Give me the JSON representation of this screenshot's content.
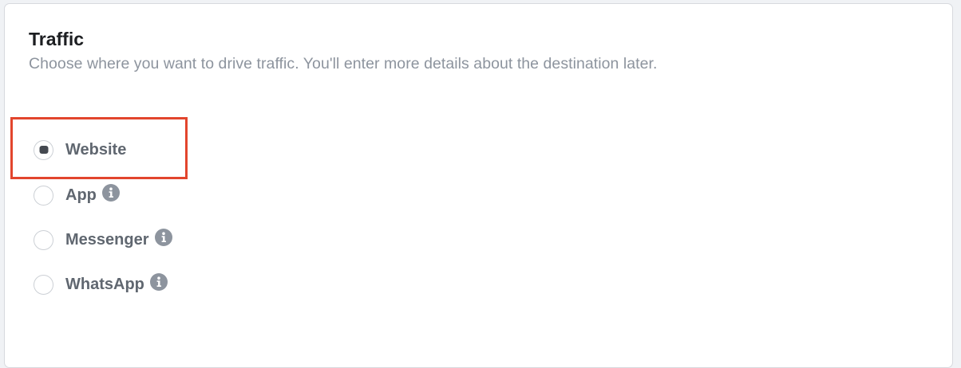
{
  "section": {
    "title": "Traffic",
    "subtitle": "Choose where you want to drive traffic. You'll enter more details about the destination later."
  },
  "options": [
    {
      "label": "Website",
      "selected": true,
      "info_icon": false
    },
    {
      "label": "App",
      "selected": false,
      "info_icon": true
    },
    {
      "label": "Messenger",
      "selected": false,
      "info_icon": true
    },
    {
      "label": "WhatsApp",
      "selected": false,
      "info_icon": true
    }
  ],
  "icons": {
    "info": "info-icon"
  },
  "colors": {
    "highlight": "#e2452d",
    "label": "#606770",
    "subtitle": "#8d949e",
    "info_icon": "#8d949e"
  }
}
